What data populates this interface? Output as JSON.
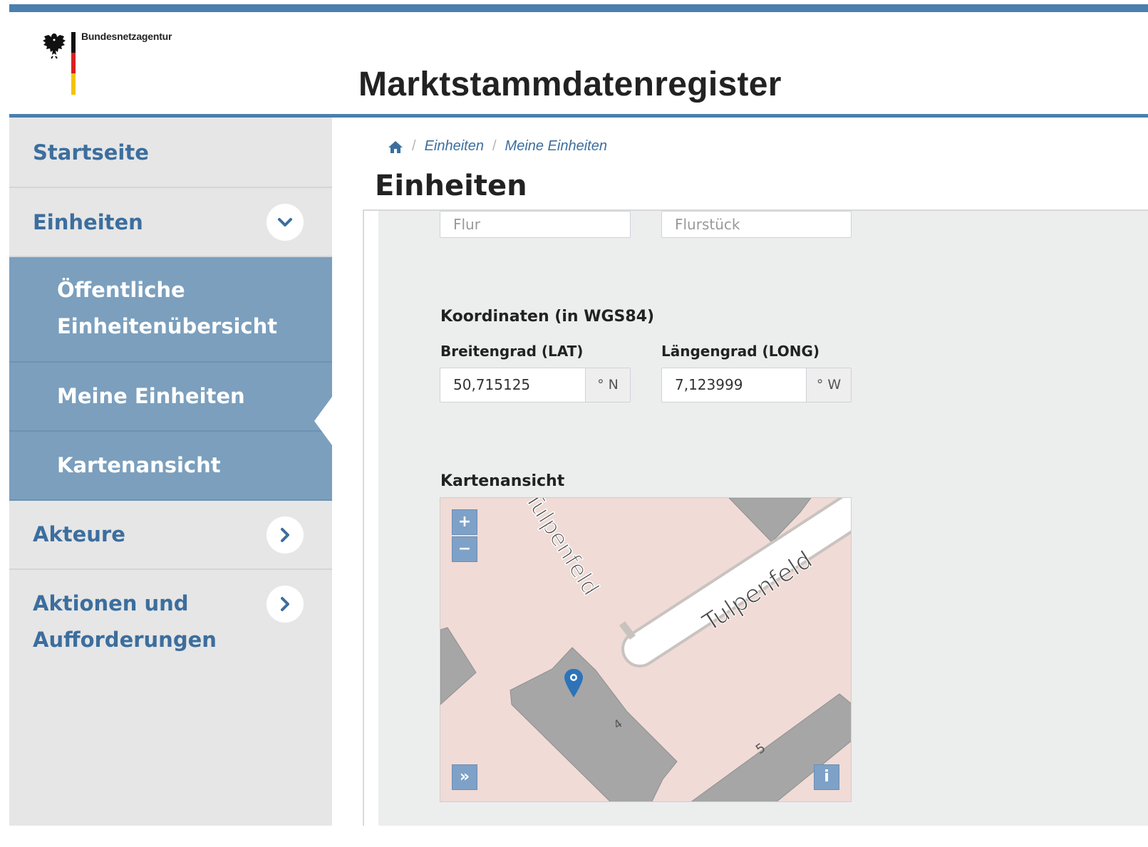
{
  "header": {
    "agency": "Bundesnetzagentur",
    "site_title": "Marktstammdatenregister",
    "flag_colors": [
      "#111111",
      "#d91f1f",
      "#f4c300"
    ]
  },
  "sidebar": {
    "items": [
      {
        "label": "Startseite",
        "icon": null
      },
      {
        "label": "Einheiten",
        "icon": "chevron-down-icon",
        "expanded": true,
        "children": [
          {
            "label_line1": "Öffentliche",
            "label_line2": "Einheitenübersicht"
          },
          {
            "label": "Meine Einheiten",
            "active": true
          },
          {
            "label": "Kartenansicht"
          }
        ]
      },
      {
        "label": "Akteure",
        "icon": "chevron-right-icon"
      },
      {
        "label_line1": "Aktionen und",
        "label_line2": "Aufforderungen",
        "icon": "chevron-right-icon"
      }
    ]
  },
  "breadcrumb": {
    "home_icon": "home-icon",
    "items": [
      "Einheiten",
      "Meine Einheiten"
    ],
    "separator": "/"
  },
  "main": {
    "page_title": "Einheiten",
    "flur_placeholder": "Flur",
    "flurstueck_placeholder": "Flurstück",
    "coordinates_heading": "Koordinaten (in WGS84)",
    "lat_label": "Breitengrad (LAT)",
    "lat_value": "50,715125",
    "lat_unit": "° N",
    "long_label": "Längengrad (LONG)",
    "long_value": "7,123999",
    "long_unit": "° W",
    "map_heading": "Kartenansicht"
  },
  "map": {
    "street_label_1": "Tulpenfeld",
    "street_label_2": "Tulpenfeld",
    "zoom_in": "+",
    "zoom_out": "−",
    "expand": "»",
    "info": "i",
    "house_number_1": "4",
    "house_number_2": "5"
  },
  "colors": {
    "accent": "#4a7fae",
    "nav_text": "#3c6e9e",
    "submenu_bg": "#7b9fbd",
    "map_land": "#f0dbd6",
    "map_building": "#a6a6a6",
    "map_button": "#7ea1c7"
  }
}
